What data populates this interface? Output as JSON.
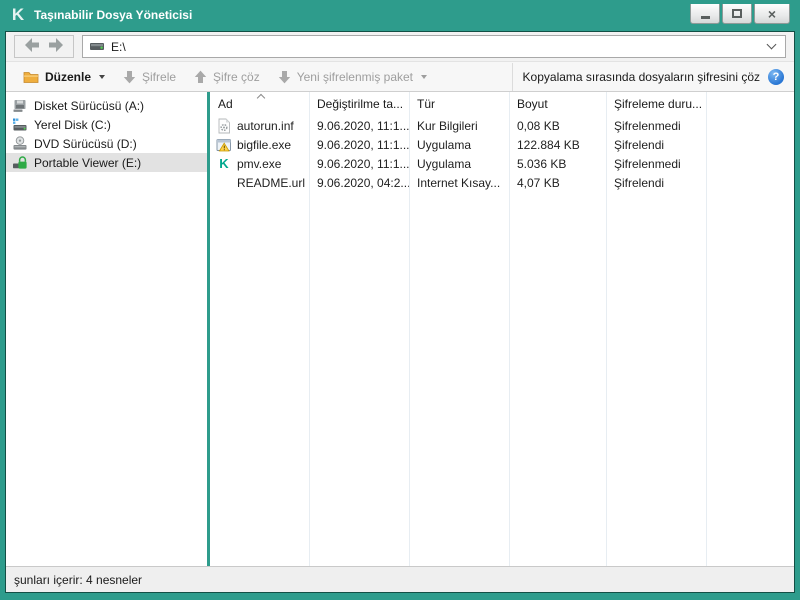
{
  "window": {
    "title": "Taşınabilir Dosya Yöneticisi",
    "logo_glyph": "K",
    "controls": [
      {
        "name": "minimize"
      },
      {
        "name": "maximize"
      },
      {
        "name": "close"
      }
    ]
  },
  "address_bar": {
    "back_icon": "back-arrow",
    "forward_icon": "forward-arrow",
    "drive_icon": "drive",
    "path": "E:\\"
  },
  "toolbar": {
    "buttons": [
      {
        "label": "Düzenle",
        "icon": "folder",
        "enabled": true,
        "has_dropdown": true
      },
      {
        "label": "Şifrele",
        "icon": "arrow-down",
        "enabled": false,
        "has_dropdown": false
      },
      {
        "label": "Şifre çöz",
        "icon": "arrow-up",
        "enabled": false,
        "has_dropdown": false
      },
      {
        "label": "Yeni şifrelenmiş paket",
        "icon": "arrow-down",
        "enabled": false,
        "has_dropdown": true
      }
    ],
    "right_label": "Kopyalama sırasında dosyaların şifresini çöz",
    "help_glyph": "?"
  },
  "sidebar": {
    "items": [
      {
        "label": "Disket Sürücüsü (A:)",
        "icon": "floppy-drive",
        "selected": false
      },
      {
        "label": "Yerel Disk (C:)",
        "icon": "hard-drive",
        "selected": false
      },
      {
        "label": "DVD Sürücüsü (D:)",
        "icon": "dvd-drive",
        "selected": false
      },
      {
        "label": "Portable Viewer (E:)",
        "icon": "locked-drive",
        "selected": true
      }
    ]
  },
  "file_list": {
    "columns": [
      {
        "label": "Ad",
        "sorted": "asc"
      },
      {
        "label": "Değiştirilme ta..."
      },
      {
        "label": "Tür"
      },
      {
        "label": "Boyut"
      },
      {
        "label": "Şifreleme duru..."
      }
    ],
    "rows": [
      {
        "name": "autorun.inf",
        "icon": "inf-file",
        "modified": "9.06.2020, 11:1...",
        "type": "Kur Bilgileri",
        "size": "0,08 KB",
        "encryption": "Şifrelenmedi"
      },
      {
        "name": "bigfile.exe",
        "icon": "exe-file",
        "modified": "9.06.2020, 11:1...",
        "type": "Uygulama",
        "size": "122.884 KB",
        "encryption": "Şifrelendi"
      },
      {
        "name": "pmv.exe",
        "icon": "kaspersky-app",
        "modified": "9.06.2020, 11:1...",
        "type": "Uygulama",
        "size": "5.036 KB",
        "encryption": "Şifrelenmedi"
      },
      {
        "name": "README.url",
        "icon": "none",
        "modified": "9.06.2020, 04:2...",
        "type": "Internet Kısay...",
        "size": "4,07 KB",
        "encryption": "Şifrelendi"
      }
    ]
  },
  "status_bar": {
    "text": "şunları içerir: 4 nesneler"
  },
  "colors": {
    "accent_teal": "#2E9C8C",
    "frame_border": "#134F45",
    "disabled_gray": "#9E9E9E",
    "help_blue": "#2A77D4",
    "selection_gray": "#E2E2E2",
    "kaspersky_green": "#00A88E",
    "lock_green": "#2FAA46",
    "warning_yellow": "#FFD24A"
  }
}
